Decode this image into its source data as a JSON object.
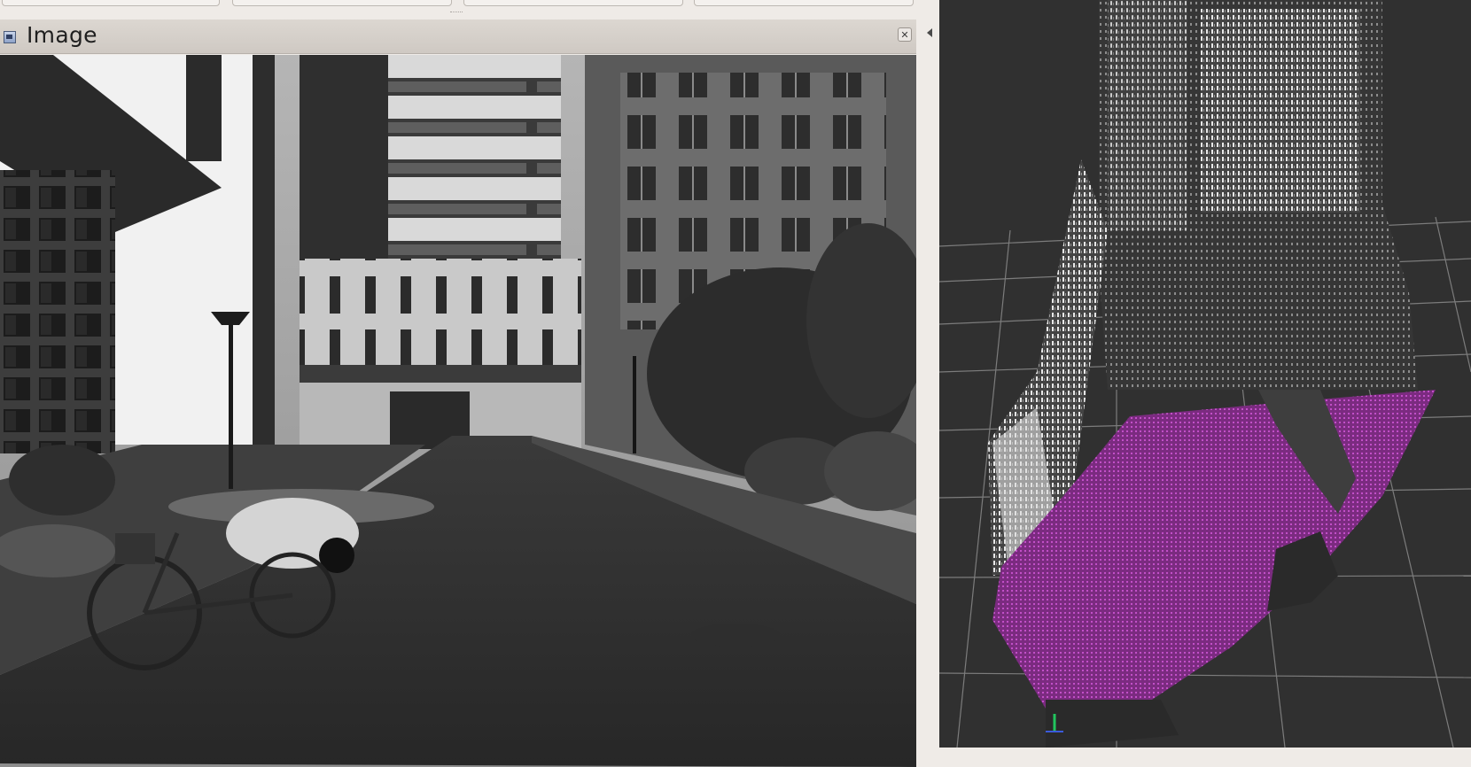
{
  "image_panel": {
    "title": "Image",
    "close_glyph": "✕"
  },
  "icons": {
    "title_icon": "image-window-icon",
    "close": "close-icon",
    "collapse": "triangle-left-icon"
  },
  "colors": {
    "panel_bg": "#efebe7",
    "viewport_bg": "#303030",
    "grid_line": "#7a7a7a",
    "ground_points": "#9b3fa0"
  }
}
